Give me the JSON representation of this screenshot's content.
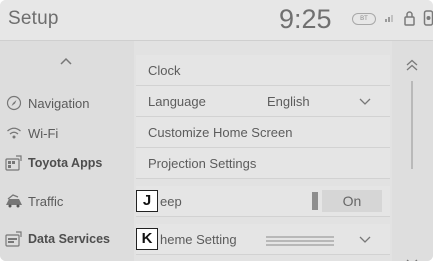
{
  "header": {
    "title": "Setup",
    "time": "9:25",
    "bt_badge": "BT"
  },
  "nav": {
    "items": [
      {
        "label": "Navigation",
        "icon": "navigation-icon"
      },
      {
        "label": "Wi-Fi",
        "icon": "wifi-icon"
      },
      {
        "label": "Toyota Apps",
        "icon": "toyota-apps-icon"
      },
      {
        "label": "Traffic",
        "icon": "traffic-icon"
      },
      {
        "label": "Data Services",
        "icon": "data-services-icon"
      }
    ]
  },
  "list": {
    "rows": [
      {
        "label": "Clock"
      },
      {
        "label": "Language",
        "value": "English"
      },
      {
        "label": "Customize Home Screen"
      },
      {
        "label": "Projection Settings"
      },
      {
        "label": "eep",
        "callout": "J",
        "toggle": "On"
      },
      {
        "label": "heme Setting",
        "callout": "K"
      }
    ]
  },
  "colors": {
    "background": "#e2e2e2",
    "text": "#5c5c5c",
    "callout_border": "#222222"
  }
}
